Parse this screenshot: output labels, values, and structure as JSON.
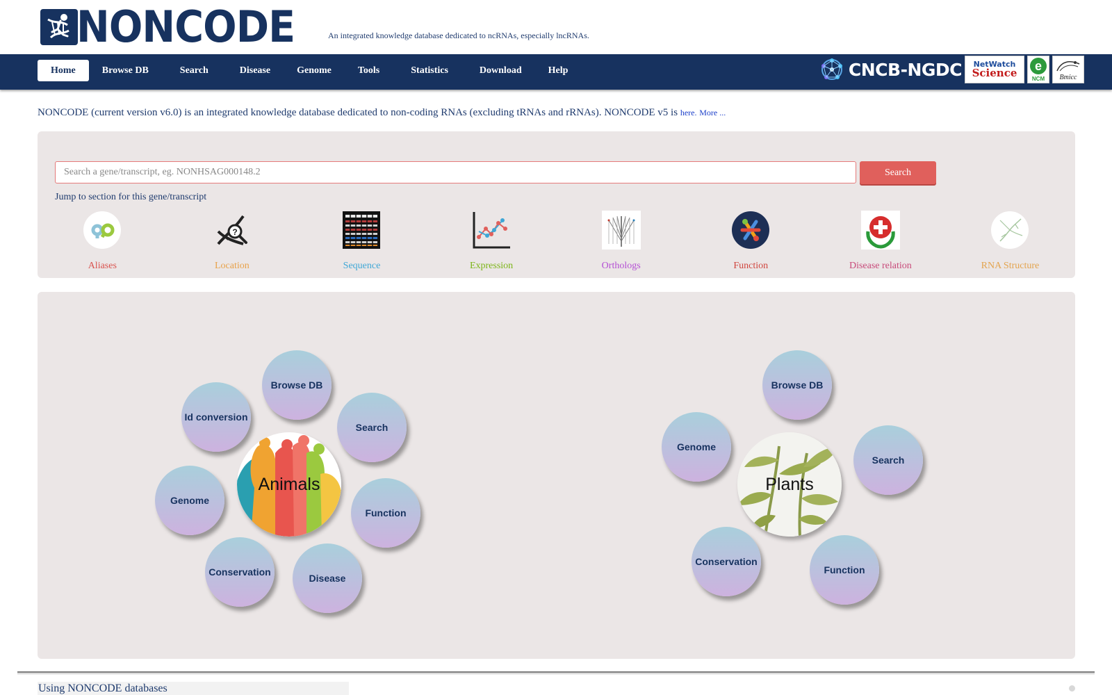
{
  "header": {
    "logo_text": "NONCODE",
    "tagline": "An integrated knowledge database dedicated to ncRNAs, especially lncRNAs."
  },
  "nav": {
    "items": [
      {
        "label": "Home",
        "active": true
      },
      {
        "label": "Browse DB"
      },
      {
        "label": "Search"
      },
      {
        "label": "Disease"
      },
      {
        "label": "Genome"
      },
      {
        "label": "Tools"
      },
      {
        "label": "Statistics"
      },
      {
        "label": "Download"
      },
      {
        "label": "Help"
      }
    ],
    "partners": {
      "cncb": "CNCB-NGDC",
      "netwatch_top": "NetWatch",
      "netwatch_bottom": "Science",
      "ncm": "NCM",
      "bmicc": "Bmicc"
    }
  },
  "intro": {
    "text": "NONCODE (current version v6.0) is an integrated knowledge database dedicated to non-coding RNAs (excluding tRNAs and rRNAs). NONCODE v5 is ",
    "here_link": "here.",
    "more_link": "More ..."
  },
  "search": {
    "placeholder": "Search a gene/transcript, eg. NONHSAG000148.2",
    "button_label": "Search",
    "jump_label": "Jump to section for this gene/transcript",
    "sections": [
      {
        "label": "Aliases",
        "color": "#d9534f",
        "icon": "aliases-icon"
      },
      {
        "label": "Location",
        "color": "#e8a24a",
        "icon": "location-icon"
      },
      {
        "label": "Sequence",
        "color": "#3fa7d6",
        "icon": "sequence-icon"
      },
      {
        "label": "Expression",
        "color": "#7cb518",
        "icon": "expression-icon"
      },
      {
        "label": "Orthologs",
        "color": "#b44fd4",
        "icon": "orthologs-icon"
      },
      {
        "label": "Function",
        "color": "#d0463f",
        "icon": "function-icon"
      },
      {
        "label": "Disease relation",
        "color": "#c84a7a",
        "icon": "disease-relation-icon"
      },
      {
        "label": "RNA Structure",
        "color": "#e3a44f",
        "icon": "rna-structure-icon"
      }
    ]
  },
  "animals": {
    "center_label": "Animals",
    "bubbles": [
      "Browse DB",
      "Id conversion",
      "Search",
      "Genome",
      "Function",
      "Conservation",
      "Disease"
    ]
  },
  "plants": {
    "center_label": "Plants",
    "bubbles": [
      "Browse DB",
      "Genome",
      "Search",
      "Conservation",
      "Function"
    ]
  },
  "footer": {
    "title": "Using NONCODE databases"
  }
}
